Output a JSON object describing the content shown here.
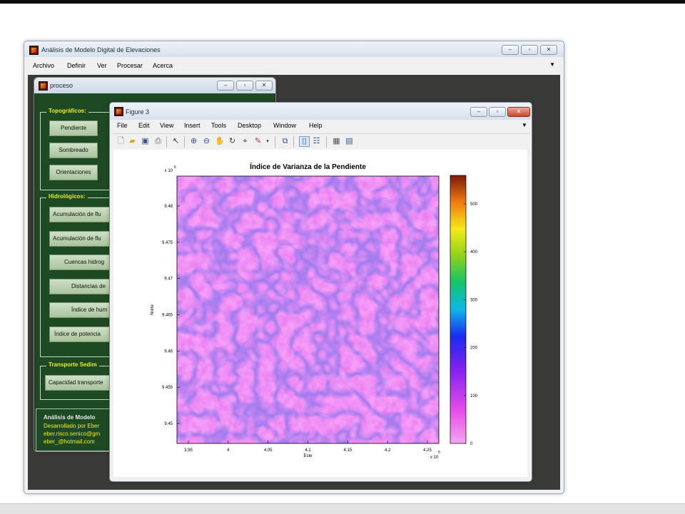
{
  "main_window": {
    "title": "Análisis de Modelo Digital de Elevaciones",
    "menu": [
      "Archivo",
      "Definir",
      "Ver",
      "Procesar",
      "Acerca"
    ]
  },
  "proceso_window": {
    "title": "proceso",
    "topo_group": {
      "label": "Topográficos:",
      "buttons": [
        "Pendiente",
        "Sombreado",
        "Orientaciones"
      ]
    },
    "hidro_group": {
      "label": "Hidrológicos:",
      "buttons": [
        "Acumulación de flu",
        "Acumulación de flu",
        "Cuencas hidrog",
        "Distancias de",
        "Índice de hum",
        "Índice de potencia"
      ]
    },
    "transport_group": {
      "label": "Transporte Sedim",
      "buttons": [
        "Capacidad transporte"
      ]
    },
    "info": {
      "title": "Análisis de Modelo",
      "lines": [
        "Desarrollado por Eber",
        "eber.risco.senico@gm",
        "eber_@hotmail.com"
      ]
    }
  },
  "figure_window": {
    "title": "Figure 3",
    "menu": [
      "File",
      "Edit",
      "View",
      "Insert",
      "Tools",
      "Desktop",
      "Window",
      "Help"
    ],
    "toolbar_icons": [
      "new-file-icon",
      "open-folder-icon",
      "save-icon",
      "print-icon",
      "pointer-icon",
      "zoom-in-icon",
      "zoom-out-icon",
      "pan-hand-icon",
      "rotate-3d-icon",
      "data-cursor-icon",
      "brush-icon",
      "link-plot-icon",
      "colorbar-icon",
      "legend-icon",
      "hide-plot-tools-icon",
      "show-plot-tools-icon"
    ]
  },
  "colors": {
    "gui_background": "#1e4a23",
    "group_label": "#eaea22",
    "map_base": "#e05ae8",
    "map_channels": "#3a2fc0"
  },
  "chart_data": {
    "type": "heatmap",
    "title": "Índice de Varianza de la Pendiente",
    "xlabel": "Este",
    "ylabel": "Norte",
    "x_ticks": [
      "3.95",
      "4",
      "4.05",
      "4.1",
      "4.15",
      "4.2",
      "4.25"
    ],
    "x_exponent": "x 10",
    "x_exponent_power": "5",
    "y_ticks": [
      "9.48",
      "9.475",
      "9.47",
      "9.465",
      "9.46",
      "9.455",
      "9.45"
    ],
    "y_exponent": "x 10",
    "y_exponent_power": "6",
    "colorbar": {
      "colormap": "jet-reversed-to-magenta",
      "ticks": [
        "500",
        "400",
        "300",
        "200",
        "100",
        "0"
      ]
    }
  }
}
